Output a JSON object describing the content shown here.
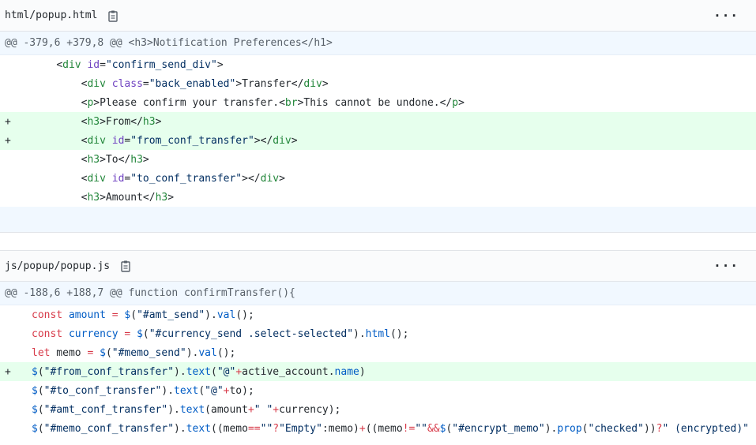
{
  "files": [
    {
      "path": "html/popup.html",
      "hunk": "@@ -379,6 +379,8 @@ <h3>Notification Preferences</h1>",
      "lines": [
        {
          "sign": "",
          "indent": "    ",
          "tokens": [
            [
              "",
              "<"
            ],
            [
              "t",
              "div"
            ],
            [
              "",
              " "
            ],
            [
              "a",
              "id"
            ],
            [
              "",
              "="
            ],
            [
              "s",
              "\"confirm_send_div\""
            ],
            [
              "",
              ">"
            ]
          ]
        },
        {
          "sign": "",
          "indent": "        ",
          "tokens": [
            [
              "",
              "<"
            ],
            [
              "t",
              "div"
            ],
            [
              "",
              " "
            ],
            [
              "a",
              "class"
            ],
            [
              "",
              "="
            ],
            [
              "s",
              "\"back_enabled\""
            ],
            [
              "",
              ">Transfer</"
            ],
            [
              "t",
              "div"
            ],
            [
              "",
              ">"
            ]
          ]
        },
        {
          "sign": "",
          "indent": "        ",
          "tokens": [
            [
              "",
              "<"
            ],
            [
              "t",
              "p"
            ],
            [
              "",
              ">Please confirm your transfer.<"
            ],
            [
              "t",
              "br"
            ],
            [
              "",
              ">This cannot be undone.</"
            ],
            [
              "t",
              "p"
            ],
            [
              "",
              ">"
            ]
          ]
        },
        {
          "sign": "+",
          "indent": "        ",
          "tokens": [
            [
              "",
              "<"
            ],
            [
              "t",
              "h3"
            ],
            [
              "",
              ">From</"
            ],
            [
              "t",
              "h3"
            ],
            [
              "",
              ">"
            ]
          ]
        },
        {
          "sign": "+",
          "indent": "        ",
          "tokens": [
            [
              "",
              "<"
            ],
            [
              "t",
              "div"
            ],
            [
              "",
              " "
            ],
            [
              "a",
              "id"
            ],
            [
              "",
              "="
            ],
            [
              "s",
              "\"from_conf_transfer\""
            ],
            [
              "",
              "></"
            ],
            [
              "t",
              "div"
            ],
            [
              "",
              ">"
            ]
          ]
        },
        {
          "sign": "",
          "indent": "        ",
          "tokens": [
            [
              "",
              "<"
            ],
            [
              "t",
              "h3"
            ],
            [
              "",
              ">To</"
            ],
            [
              "t",
              "h3"
            ],
            [
              "",
              ">"
            ]
          ]
        },
        {
          "sign": "",
          "indent": "        ",
          "tokens": [
            [
              "",
              "<"
            ],
            [
              "t",
              "div"
            ],
            [
              "",
              " "
            ],
            [
              "a",
              "id"
            ],
            [
              "",
              "="
            ],
            [
              "s",
              "\"to_conf_transfer\""
            ],
            [
              "",
              "></"
            ],
            [
              "t",
              "div"
            ],
            [
              "",
              ">"
            ]
          ]
        },
        {
          "sign": "",
          "indent": "        ",
          "tokens": [
            [
              "",
              "<"
            ],
            [
              "t",
              "h3"
            ],
            [
              "",
              ">Amount</"
            ],
            [
              "t",
              "h3"
            ],
            [
              "",
              ">"
            ]
          ]
        }
      ]
    },
    {
      "path": "js/popup/popup.js",
      "hunk": "@@ -188,6 +188,7 @@ function confirmTransfer(){",
      "lines": [
        {
          "sign": "",
          "indent": "",
          "tokens": [
            [
              "k",
              "const"
            ],
            [
              "",
              " "
            ],
            [
              "p",
              "amount"
            ],
            [
              "",
              " "
            ],
            [
              "k",
              "="
            ],
            [
              "",
              " "
            ],
            [
              "p",
              "$"
            ],
            [
              "",
              "("
            ],
            [
              "s",
              "\"#amt_send\""
            ],
            [
              "",
              ")."
            ],
            [
              "p",
              "val"
            ],
            [
              "",
              "();"
            ]
          ]
        },
        {
          "sign": "",
          "indent": "",
          "tokens": [
            [
              "k",
              "const"
            ],
            [
              "",
              " "
            ],
            [
              "p",
              "currency"
            ],
            [
              "",
              " "
            ],
            [
              "k",
              "="
            ],
            [
              "",
              " "
            ],
            [
              "p",
              "$"
            ],
            [
              "",
              "("
            ],
            [
              "s",
              "\"#currency_send .select-selected\""
            ],
            [
              "",
              ")."
            ],
            [
              "p",
              "html"
            ],
            [
              "",
              "();"
            ]
          ]
        },
        {
          "sign": "",
          "indent": "",
          "tokens": [
            [
              "k",
              "let"
            ],
            [
              "",
              " memo "
            ],
            [
              "k",
              "="
            ],
            [
              "",
              " "
            ],
            [
              "p",
              "$"
            ],
            [
              "",
              "("
            ],
            [
              "s",
              "\"#memo_send\""
            ],
            [
              "",
              ")."
            ],
            [
              "p",
              "val"
            ],
            [
              "",
              "();"
            ]
          ]
        },
        {
          "sign": "+",
          "indent": "",
          "tokens": [
            [
              "p",
              "$"
            ],
            [
              "",
              "("
            ],
            [
              "s",
              "\"#from_conf_transfer\""
            ],
            [
              "",
              ")."
            ],
            [
              "p",
              "text"
            ],
            [
              "",
              "("
            ],
            [
              "s",
              "\"@\""
            ],
            [
              "k",
              "+"
            ],
            [
              "",
              "active_account."
            ],
            [
              "p",
              "name"
            ],
            [
              "",
              ")"
            ]
          ]
        },
        {
          "sign": "",
          "indent": "",
          "tokens": [
            [
              "p",
              "$"
            ],
            [
              "",
              "("
            ],
            [
              "s",
              "\"#to_conf_transfer\""
            ],
            [
              "",
              ")."
            ],
            [
              "p",
              "text"
            ],
            [
              "",
              "("
            ],
            [
              "s",
              "\"@\""
            ],
            [
              "k",
              "+"
            ],
            [
              "",
              "to);"
            ]
          ]
        },
        {
          "sign": "",
          "indent": "",
          "tokens": [
            [
              "p",
              "$"
            ],
            [
              "",
              "("
            ],
            [
              "s",
              "\"#amt_conf_transfer\""
            ],
            [
              "",
              ")."
            ],
            [
              "p",
              "text"
            ],
            [
              "",
              "(amount"
            ],
            [
              "k",
              "+"
            ],
            [
              "s",
              "\" \""
            ],
            [
              "k",
              "+"
            ],
            [
              "",
              "currency);"
            ]
          ]
        },
        {
          "sign": "",
          "indent": "",
          "tokens": [
            [
              "p",
              "$"
            ],
            [
              "",
              "("
            ],
            [
              "s",
              "\"#memo_conf_transfer\""
            ],
            [
              "",
              ")."
            ],
            [
              "p",
              "text"
            ],
            [
              "",
              "((memo"
            ],
            [
              "k",
              "=="
            ],
            [
              "s",
              "\"\""
            ],
            [
              "k",
              "?"
            ],
            [
              "s",
              "\"Empty\""
            ],
            [
              "",
              ":memo)"
            ],
            [
              "k",
              "+"
            ],
            [
              "",
              "((memo"
            ],
            [
              "k",
              "!="
            ],
            [
              "s",
              "\"\""
            ],
            [
              "k",
              "&&"
            ],
            [
              "p",
              "$"
            ],
            [
              "",
              "("
            ],
            [
              "s",
              "\"#encrypt_memo\""
            ],
            [
              "",
              ")."
            ],
            [
              "p",
              "prop"
            ],
            [
              "",
              "("
            ],
            [
              "s",
              "\"checked\""
            ],
            [
              "",
              "))"
            ],
            [
              "k",
              "?"
            ],
            [
              "s",
              "\" (encrypted)\""
            ]
          ]
        }
      ]
    }
  ],
  "icons": {
    "copy": "clipboard-icon",
    "more": "kebab-menu-icon"
  },
  "colors": {
    "addition_bg": "#e6ffed",
    "hunk_bg": "#f1f8ff",
    "header_bg": "#fafbfc"
  }
}
